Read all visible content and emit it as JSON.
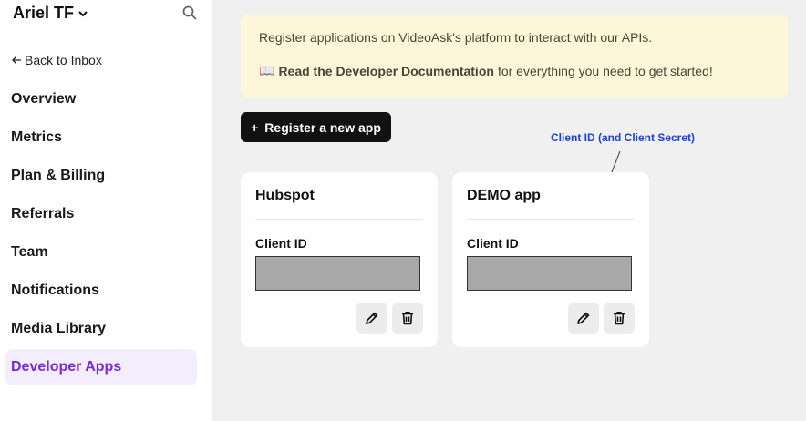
{
  "sidebar": {
    "workspace_name": "Ariel TF",
    "back_label": "Back to Inbox",
    "items": [
      {
        "label": "Overview"
      },
      {
        "label": "Metrics"
      },
      {
        "label": "Plan & Billing"
      },
      {
        "label": "Referrals"
      },
      {
        "label": "Team"
      },
      {
        "label": "Notifications"
      },
      {
        "label": "Media Library"
      },
      {
        "label": "Developer Apps",
        "active": true
      }
    ]
  },
  "banner": {
    "text": "Register applications on VideoAsk's platform to interact with our APIs.",
    "book_icon": "📖",
    "link_text": "Read the Developer Documentation",
    "link_suffix": "for everything you need to get started!"
  },
  "register_button": {
    "plus": "+",
    "label": "Register a new app"
  },
  "annotation": {
    "text": "Client ID (and Client Secret)",
    "color": "#1f3fe6"
  },
  "apps": [
    {
      "name": "Hubspot",
      "client_id_label": "Client ID"
    },
    {
      "name": "DEMO app",
      "client_id_label": "Client ID"
    }
  ],
  "colors": {
    "accent": "#7a2bd6",
    "banner_bg": "#fdf6d8",
    "button_bg": "#111111"
  }
}
